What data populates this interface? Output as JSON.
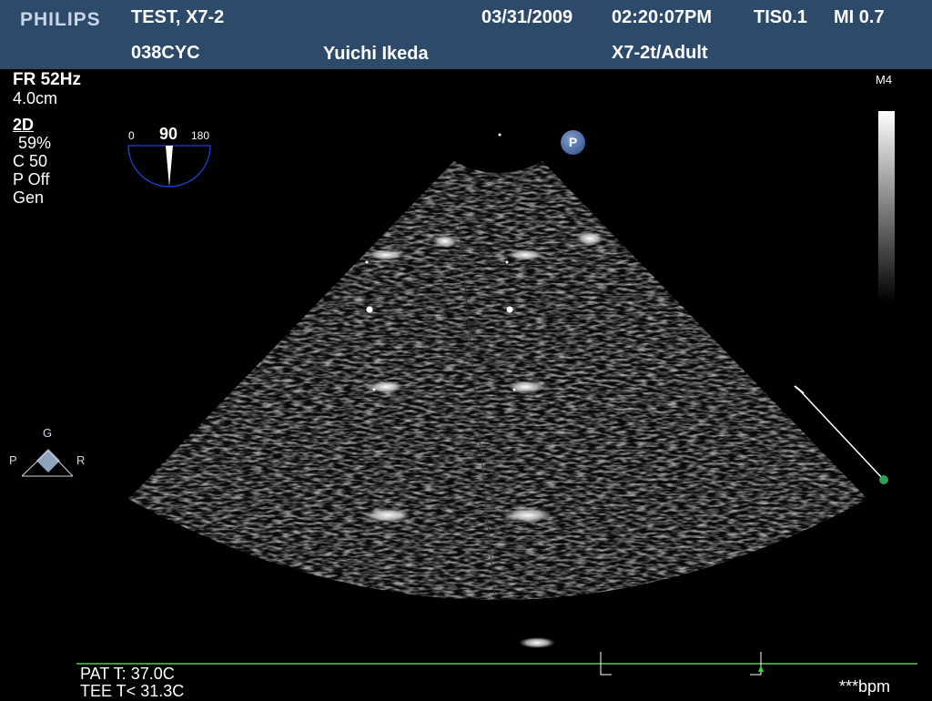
{
  "header": {
    "brand": "PHILIPS",
    "patient_name": "TEST, X7-2",
    "patient_id": "038CYC",
    "date": "03/31/2009",
    "time": "02:20:07PM",
    "tis": "TIS0.1",
    "mi": "MI 0.7",
    "operator": "Yuichi Ikeda",
    "probe_preset": "X7-2t/Adult"
  },
  "params": {
    "frame_rate": "FR 52Hz",
    "depth": "4.0cm",
    "mode": "2D",
    "gain": "59%",
    "compression": "C 50",
    "persistence": "P Off",
    "resolution": "Gen"
  },
  "angle_gauge": {
    "min_label": "0",
    "value": "90",
    "max_label": "180"
  },
  "map_label": "M4",
  "probe_marker": "P",
  "orientation": {
    "top": "G",
    "left": "P",
    "right": "R"
  },
  "footer": {
    "pat_temp": "PAT T: 37.0C",
    "tee_temp": "TEE T< 31.3C",
    "heart_rate": "***bpm"
  },
  "colors": {
    "header_bg": "#2d4a6b",
    "ecg_trace": "#3ddc3d",
    "angle_arc": "#1f3fd1",
    "focus_marker": "#2fa04f"
  }
}
